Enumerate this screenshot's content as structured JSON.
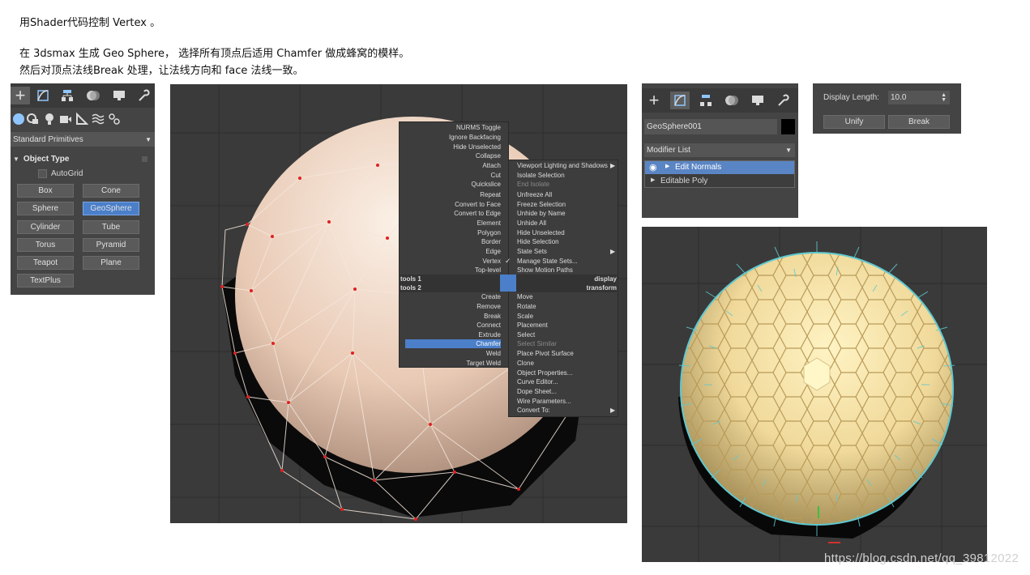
{
  "intro": {
    "line1": "用Shader代码控制 Vertex 。",
    "line2": "在 3dsmax  生成 Geo Sphere， 选择所有顶点后适用 Chamfer 做成蜂窝的模样。",
    "line3": "然后对顶点法线Break 处理，让法线方向和 face 法线一致。"
  },
  "create_panel": {
    "tabs": [
      "plus-icon",
      "curve-icon",
      "hierarchy-icon",
      "motion-icon",
      "display-icon",
      "wrench-icon"
    ],
    "subtabs": [
      "geometry-icon",
      "shapes-icon",
      "lights-icon",
      "cameras-icon",
      "helpers-icon",
      "spacewarps-icon",
      "systems-icon"
    ],
    "category": "Standard Primitives",
    "rollout_title": "Object Type",
    "autogrid": "AutoGrid",
    "buttons": [
      "Box",
      "Cone",
      "Sphere",
      "GeoSphere",
      "Cylinder",
      "Tube",
      "Torus",
      "Pyramid",
      "Teapot",
      "Plane",
      "TextPlus"
    ],
    "selected": "GeoSphere"
  },
  "quad_menu": {
    "display_items": [
      "NURMS Toggle",
      "Ignore Backfacing",
      "Hide Unselected",
      "Collapse",
      "Attach",
      "Cut",
      "Quickslice",
      "Repeat",
      "Convert to Face",
      "Convert to Edge",
      "Element",
      "Polygon",
      "Border",
      "Edge",
      "Vertex",
      "Top-level"
    ],
    "display_right": [
      "Viewport Lighting and Shadows",
      "Isolate Selection",
      "End Isolate",
      "Unfreeze All",
      "Freeze Selection",
      "Unhide by Name",
      "Unhide All",
      "Hide Unselected",
      "Hide Selection",
      "State Sets",
      "Manage State Sets...",
      "Show Motion Paths"
    ],
    "tools1": "tools 1",
    "tools2": "tools 2",
    "display": "display",
    "transform": "transform",
    "tool_items": [
      "Create",
      "Remove",
      "Break",
      "Connect",
      "Extrude",
      "Chamfer",
      "Weld",
      "Target Weld"
    ],
    "transform_items": [
      "Move",
      "Rotate",
      "Scale",
      "Placement",
      "Select",
      "Select Similar",
      "Place Pivot Surface",
      "Clone",
      "Object Properties...",
      "Curve Editor...",
      "Dope Sheet...",
      "Wire Parameters...",
      "Convert To:"
    ],
    "highlighted": "Chamfer"
  },
  "modify_panel": {
    "object_name": "GeoSphere001",
    "modifier_list": "Modifier List",
    "stack": [
      "Edit Normals",
      "Editable Poly"
    ],
    "object_color": "#000000"
  },
  "normals_panel": {
    "display_length_label": "Display Length:",
    "display_length_value": "10.0",
    "unify": "Unify",
    "break": "Break"
  },
  "watermark": "https://blog.csdn.net/qq_39812022",
  "colors": {
    "selection_blue": "#4b7fc9",
    "sphere_shade": "#e8c9b4",
    "honeycomb": "#f0d99a",
    "normals": "#5fc8d0"
  }
}
